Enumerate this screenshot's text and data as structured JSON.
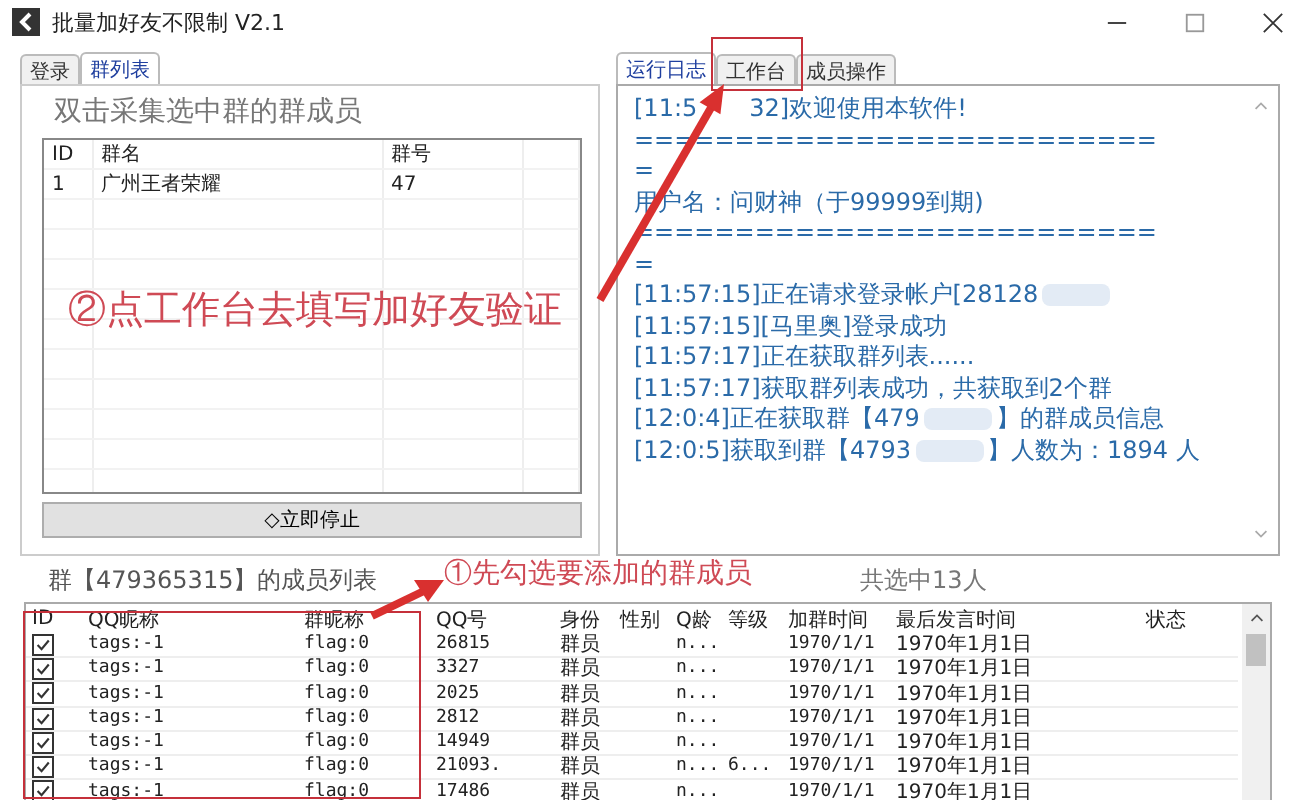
{
  "window": {
    "title": "批量加好友不限制 V2.1"
  },
  "left_panel": {
    "tabs": [
      {
        "label": "登录",
        "selected": false
      },
      {
        "label": "群列表",
        "selected": true
      }
    ],
    "hint": "双击采集选中群的群成员",
    "table": {
      "columns": [
        "ID",
        "群名",
        "群号"
      ],
      "rows": [
        {
          "id": "1",
          "name": "广州王者荣耀",
          "number": "47"
        }
      ]
    },
    "stop_button": "◇立即停止"
  },
  "right_panel": {
    "tabs": [
      {
        "label": "运行日志",
        "selected": true
      },
      {
        "label": "工作台",
        "selected": false
      },
      {
        "label": "成员操作",
        "selected": false
      }
    ],
    "log_lines": [
      {
        "kind": "covered",
        "parts": [
          "[11:5",
          "32]欢迎使用本软件!"
        ]
      },
      {
        "kind": "plain",
        "parts": [
          "=========================="
        ]
      },
      {
        "kind": "plain",
        "parts": [
          "="
        ]
      },
      {
        "kind": "plain",
        "parts": [
          "用户名：问财神（于99999到期)"
        ]
      },
      {
        "kind": "plain",
        "parts": [
          "=========================="
        ]
      },
      {
        "kind": "plain",
        "parts": [
          "="
        ]
      },
      {
        "kind": "redacted",
        "parts": [
          "[11:57:15]正在请求登录帐户[28128"
        ]
      },
      {
        "kind": "plain",
        "parts": [
          "[11:57:15][马里奥]登录成功"
        ]
      },
      {
        "kind": "plain",
        "parts": [
          "[11:57:17]正在获取群列表......"
        ]
      },
      {
        "kind": "plain",
        "parts": [
          "[11:57:17]获取群列表成功，共获取到2个群"
        ]
      },
      {
        "kind": "redacted",
        "parts": [
          "[12:0:4]正在获取群【479",
          "】的群成员信息"
        ]
      },
      {
        "kind": "redacted",
        "parts": [
          "[12:0:5]获取到群【4793",
          "】人数为：1894 人"
        ]
      }
    ]
  },
  "members": {
    "title": "群【479365315】的成员列表",
    "selected_count": "共选中13人",
    "columns": [
      "ID",
      "QQ昵称",
      "群昵称",
      "QQ号",
      "身份",
      "性别",
      "Q龄",
      "等级",
      "加群时间",
      "最后发言时间",
      "状态"
    ],
    "rows": [
      {
        "checked": true,
        "nickname": "tags:-1",
        "group_nick": "flag:0",
        "qq": "26815",
        "role": "群员",
        "q_age": "n...",
        "rank": "",
        "joined": "1970/1/1",
        "last_spoke": "1970年1月1日"
      },
      {
        "checked": true,
        "nickname": "tags:-1",
        "group_nick": "flag:0",
        "qq": "3327",
        "role": "群员",
        "q_age": "n...",
        "rank": "",
        "joined": "1970/1/1",
        "last_spoke": "1970年1月1日"
      },
      {
        "checked": true,
        "nickname": "tags:-1",
        "group_nick": "flag:0",
        "qq": "2025",
        "role": "群员",
        "q_age": "n...",
        "rank": "",
        "joined": "1970/1/1",
        "last_spoke": "1970年1月1日"
      },
      {
        "checked": true,
        "nickname": "tags:-1",
        "group_nick": "flag:0",
        "qq": "2812",
        "role": "群员",
        "q_age": "n...",
        "rank": "",
        "joined": "1970/1/1",
        "last_spoke": "1970年1月1日"
      },
      {
        "checked": true,
        "nickname": "tags:-1",
        "group_nick": "flag:0",
        "qq": "14949",
        "role": "群员",
        "q_age": "n...",
        "rank": "",
        "joined": "1970/1/1",
        "last_spoke": "1970年1月1日"
      },
      {
        "checked": true,
        "nickname": "tags:-1",
        "group_nick": "flag:0",
        "qq": "21093.",
        "role": "群员",
        "q_age": "n...",
        "rank": "6...",
        "joined": "1970/1/1",
        "last_spoke": "1970年1月1日"
      },
      {
        "checked": true,
        "nickname": "tags:-1",
        "group_nick": "flag:0",
        "qq": "17486",
        "role": "群员",
        "q_age": "n...",
        "rank": "",
        "joined": "1970/1/1",
        "last_spoke": "1970年1月1日"
      }
    ]
  },
  "annotations": [
    {
      "kind": "note",
      "text": "②点工作台去填写加好友验证"
    },
    {
      "kind": "note",
      "text": "①先勾选要添加的群成员"
    }
  ]
}
